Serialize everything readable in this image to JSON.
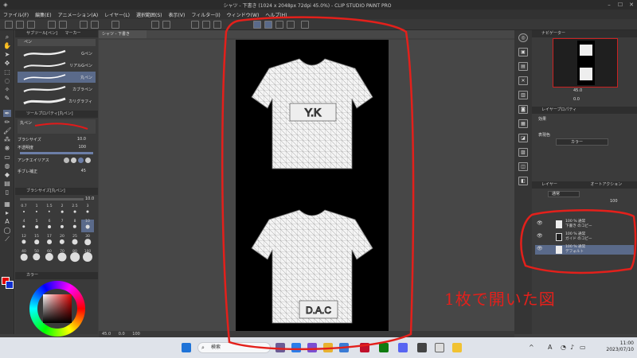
{
  "window": {
    "title": "シャツ - 下書き (1024 x 2048px 72dpi 45.0%) - CLIP STUDIO PAINT PRO"
  },
  "menu": [
    "ファイル(F)",
    "編集(E)",
    "アニメーション(A)",
    "レイヤー(L)",
    "選択範囲(S)",
    "表示(V)",
    "フィルター(I)",
    "ウィンドウ(W)",
    "ヘルプ(H)"
  ],
  "subtool": {
    "tabs": [
      "サブツール[ペン]",
      "マーカー"
    ],
    "pen_tab": "ペン",
    "brushes": [
      "Gペン",
      "リアルGペン",
      "丸ペン",
      "カブラペン",
      "カリグラフィ"
    ],
    "selected_brush": "丸ペン",
    "tool_property_header": "ツールプロパティ[丸ペン]",
    "tool_property_name": "丸ペン",
    "brush_size_label": "ブラシサイズ",
    "brush_size_value": "10.0",
    "opacity_label": "不透明度",
    "opacity_value": "100",
    "antialias_label": "アンチエイリアス",
    "stabilization_label": "手ブレ補正",
    "stabilization_value": "45",
    "brush_size_panel_header": "ブラシサイズ[丸ペン]",
    "brush_size_readout": "10.0",
    "sizes": [
      "0.7",
      "1",
      "1.5",
      "2",
      "2.5",
      "3",
      "4",
      "5",
      "6",
      "7",
      "8",
      "10",
      "12",
      "15",
      "17",
      "20",
      "25",
      "30",
      "40",
      "50",
      "60",
      "70",
      "80",
      "100"
    ],
    "selected_size": "10",
    "color_header": "カラー"
  },
  "canvas": {
    "doc_tab": "シャツ - 下書き",
    "zoom": "45.0",
    "status_values": [
      "0.0",
      "100"
    ],
    "shirt_top_text": "Y.K",
    "shirt_bottom_text": "D.A.C"
  },
  "navigator": {
    "header": "ナビゲーター",
    "zoom": "45.0",
    "rotation": "0.0"
  },
  "layer_property": {
    "header": "レイヤープロパティ",
    "effect_label": "効果",
    "expression_color_label": "表現色",
    "expression_color_value": "カラー"
  },
  "layers": {
    "tabs": [
      "レイヤー",
      "オートアクション"
    ],
    "blend_mode": "通常",
    "opacity": "100",
    "items": [
      {
        "line1": "100 % 通常",
        "line2": "下書き のコピー"
      },
      {
        "line1": "100 % 通常",
        "line2": "ガイド のコピー"
      },
      {
        "line1": "100 % 通常",
        "line2": "デフォルト"
      }
    ]
  },
  "taskbar": {
    "search_placeholder": "検索",
    "ime": "A",
    "time": "11:00",
    "date": "2023/07/10"
  },
  "annotation": {
    "text": "1枚で開いた図",
    "color": "#e3201b"
  },
  "colors": {
    "accent": "#5a6a8a",
    "main_color": "#e00000",
    "sub_color": "#1030d0"
  }
}
